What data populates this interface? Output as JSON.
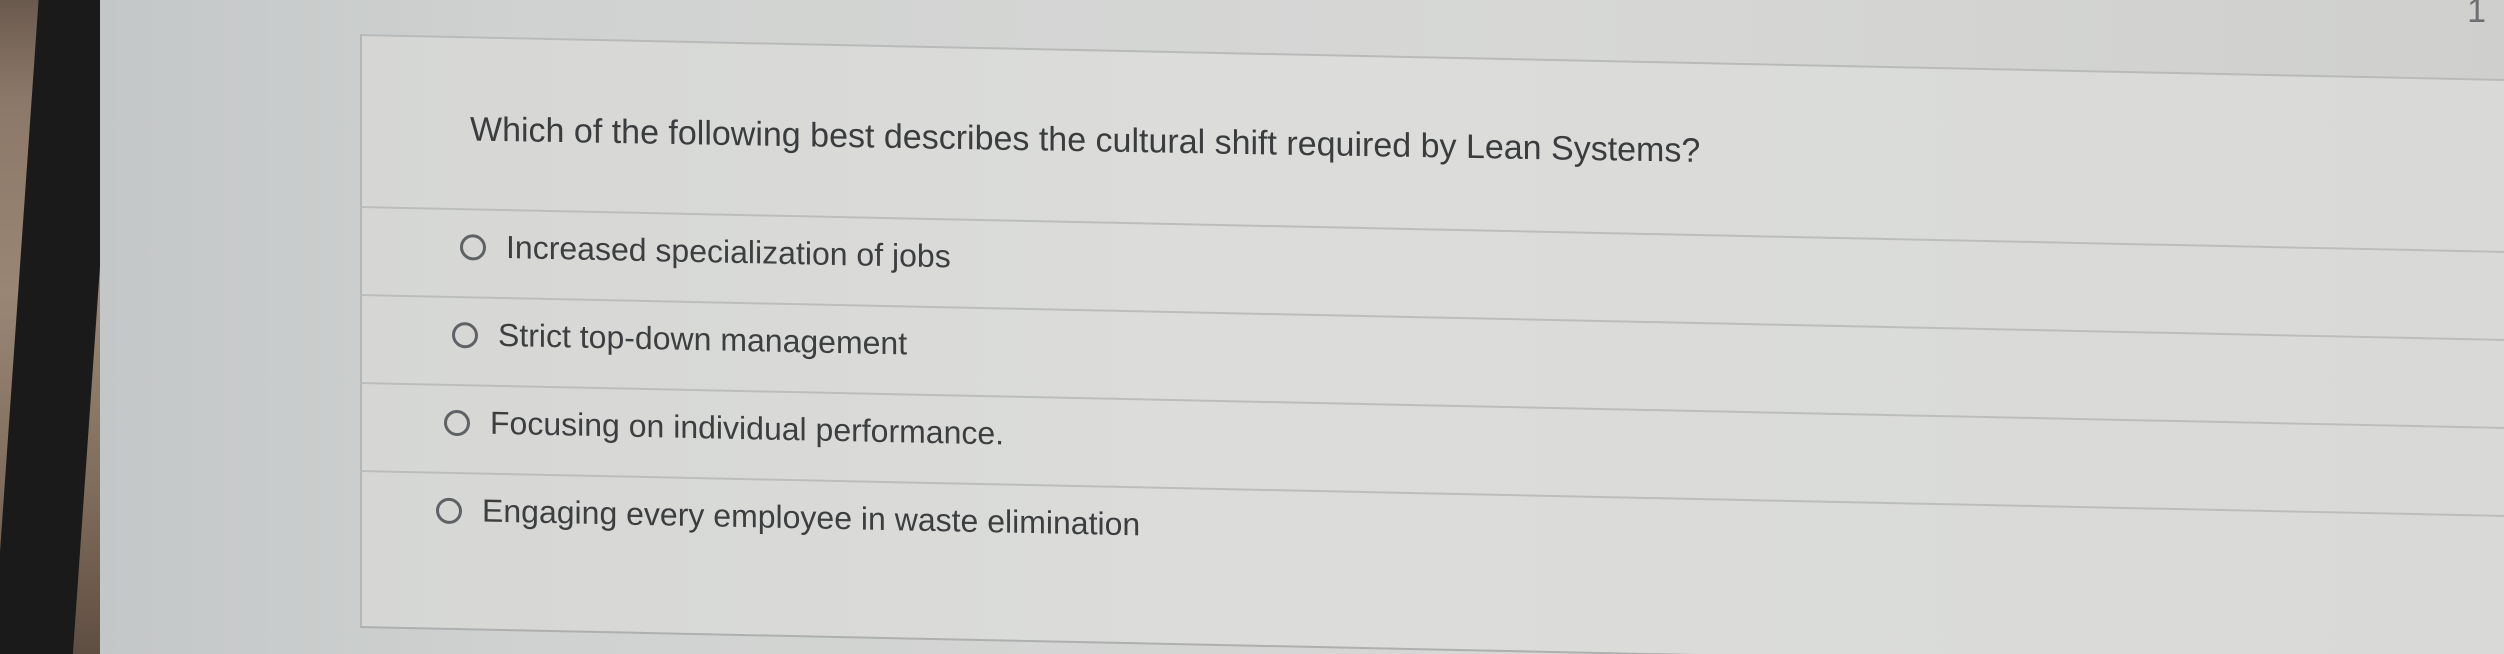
{
  "page": {
    "number": "1"
  },
  "question": {
    "text": "Which of the following best describes the cultural shift required by Lean Systems?"
  },
  "options": [
    {
      "label": "Increased specialization of jobs",
      "selected": false
    },
    {
      "label": "Strict top-down management",
      "selected": false
    },
    {
      "label": "Focusing on individual performance.",
      "selected": false
    },
    {
      "label": "Engaging every employee in waste elimination",
      "selected": false
    }
  ],
  "colors": {
    "text": "#3a3c3e",
    "divider": "#bcbebd",
    "radio_border": "#5f6264",
    "background": "#d7d8d6"
  }
}
